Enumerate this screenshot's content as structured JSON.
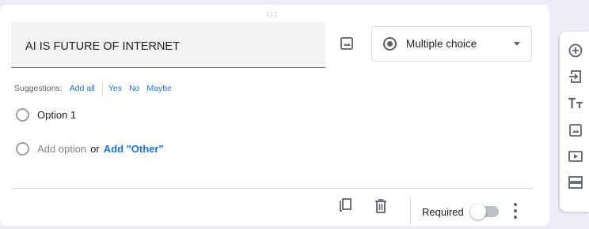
{
  "question": {
    "title": "AI IS FUTURE OF INTERNET",
    "type_label": "Multiple choice"
  },
  "suggestions": {
    "label": "Suggestions:",
    "items": [
      "Add all",
      "Yes",
      "No",
      "Maybe"
    ]
  },
  "options": [
    {
      "label": "Option 1"
    }
  ],
  "add_option": {
    "label": "Add option",
    "or": "or",
    "other_label": "Add \"Other\""
  },
  "footer": {
    "required_label": "Required",
    "required_on": false
  },
  "toolbar": {
    "icons": [
      "add-question-icon",
      "import-questions-icon",
      "add-title-icon",
      "add-image-icon",
      "add-video-icon",
      "add-section-icon"
    ]
  },
  "colors": {
    "accent": "#1a73e8",
    "background": "#f0ebf8",
    "icon": "#5f6368"
  }
}
